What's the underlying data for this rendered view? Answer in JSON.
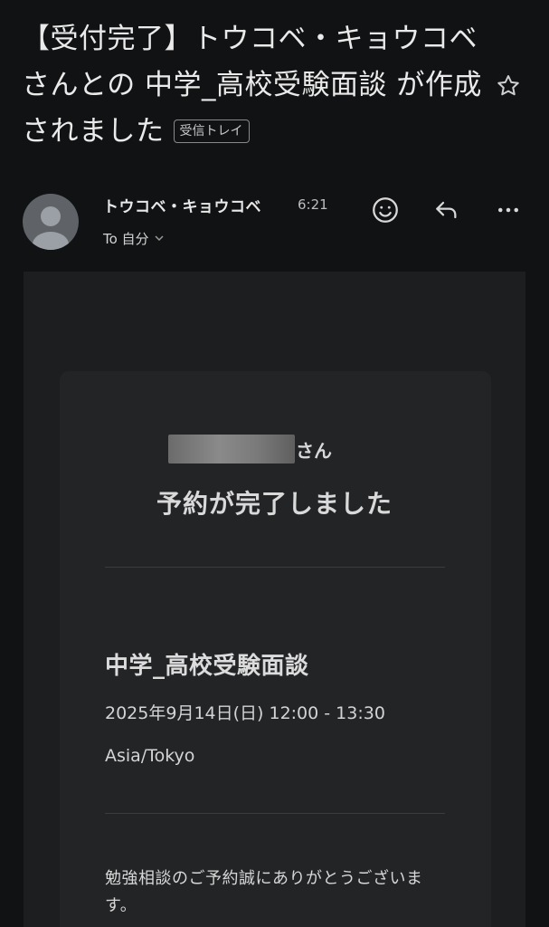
{
  "email": {
    "subject": "【受付完了】トウコベ・キョウコベさんとの 中学_高校受験面談 が作成されました",
    "label": "受信トレイ"
  },
  "sender": {
    "name": "トウコベ・キョウコベ",
    "time": "6:21",
    "recipient": "To 自分"
  },
  "icons": {
    "star": "star-icon",
    "emoji": "emoji-react-icon",
    "reply": "reply-icon",
    "more": "more-options-icon",
    "avatar": "person-avatar-icon"
  },
  "body": {
    "honorific": "さん",
    "heading": "予約が完了しました",
    "event_title": "中学_高校受験面談",
    "event_datetime": "2025年9月14日(日) 12:00 - 13:30",
    "event_timezone": "Asia/Tokyo",
    "message": "勉強相談のご予約誠にありがとうございます。"
  },
  "colors": {
    "background": "#111213",
    "body_background": "#1c1e1f",
    "card_background": "#222426",
    "text": "#e3e3e3"
  }
}
